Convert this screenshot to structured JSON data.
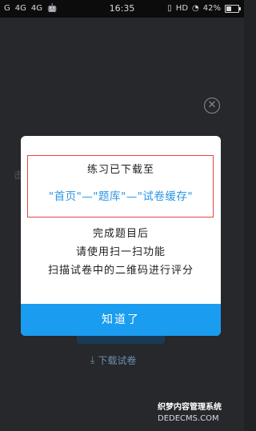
{
  "status_bar": {
    "left_items": [
      "G",
      "4G",
      "4G"
    ],
    "time": "16:35",
    "hd": "HD",
    "battery": "42%"
  },
  "background": {
    "close_icon": "close-circle-icon",
    "side_char": "击",
    "download_label": "下载试卷"
  },
  "dialog": {
    "line1": "练习已下载至",
    "line2": "\"首页\"—\"题库\"—\"试卷缓存\"",
    "line3": "完成题目后",
    "line4": "请使用扫一扫功能",
    "line5": "扫描试卷中的二维码进行评分",
    "ok_label": "知道了",
    "highlight_color": "#e64545",
    "link_color": "#2a95e8",
    "button_color": "#1a9cf0"
  },
  "watermark": {
    "line1": "织梦内容管理系统",
    "line2": "DEDECMS.COM"
  }
}
